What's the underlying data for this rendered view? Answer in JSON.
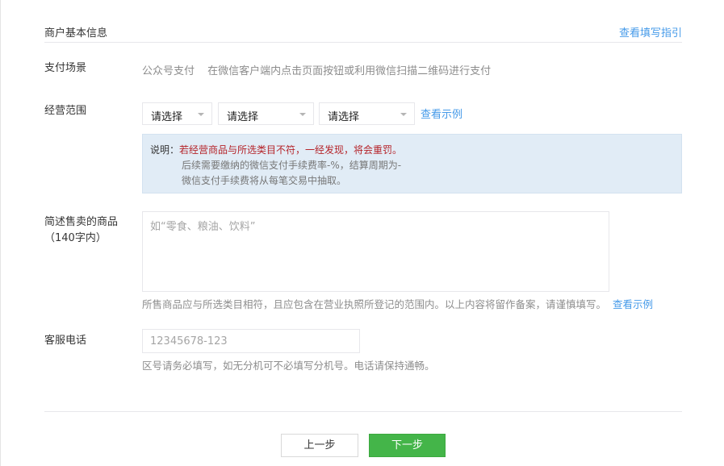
{
  "header": {
    "title": "商户基本信息",
    "guide_link": "查看填写指引"
  },
  "payment_scene": {
    "label": "支付场景",
    "type": "公众号支付",
    "description": "在微信客户端内点击页面按钮或利用微信扫描二维码进行支付"
  },
  "business_scope": {
    "label": "经营范围",
    "selects": [
      {
        "value": "请选择"
      },
      {
        "value": "请选择"
      },
      {
        "value": "请选择"
      }
    ],
    "example_link": "查看示例",
    "notice": {
      "prefix": "说明：",
      "warning": "若经营商品与所选类目不符，一经发现，将会重罚。",
      "line2": "后续需要缴纳的微信支付手续费率-%，结算周期为-",
      "line3": "微信支付手续费将从每笔交易中抽取。"
    }
  },
  "goods": {
    "label_line1": "简述售卖的商品",
    "label_line2": "（140字内）",
    "placeholder": "如“零食、粮油、饮料”",
    "help": "所售商品应与所选类目相符，且应包含在营业执照所登记的范围内。以上内容将留作备案，请谨慎填写。",
    "example_link": "查看示例"
  },
  "service_phone": {
    "label": "客服电话",
    "placeholder": "12345678-123",
    "help": "区号请务必填写，如无分机可不必填写分机号。电话请保持通畅。"
  },
  "footer": {
    "prev_label": "上一步",
    "next_label": "下一步"
  }
}
